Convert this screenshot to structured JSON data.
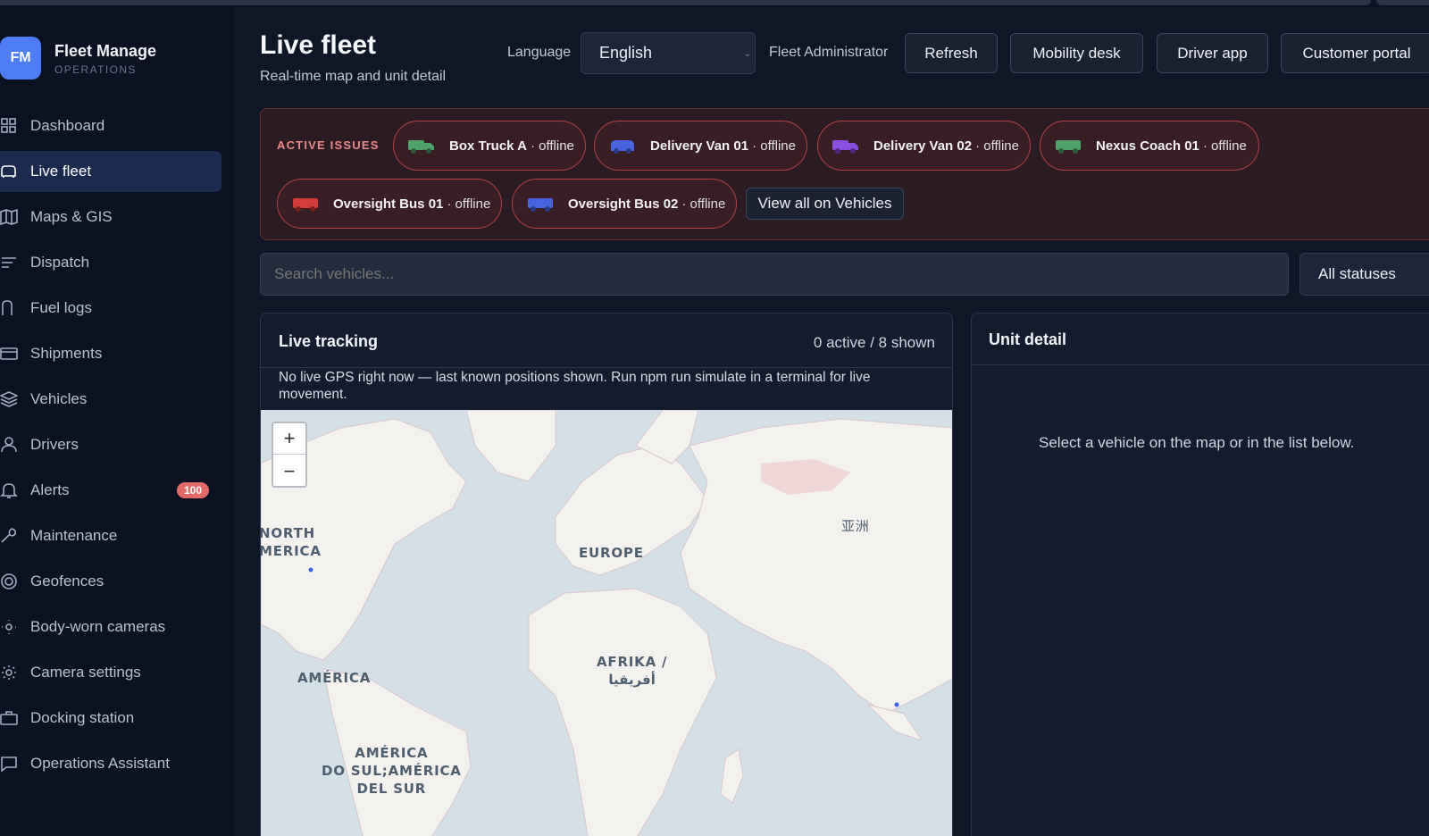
{
  "app": {
    "logo_initials": "FM",
    "name": "Fleet Manage",
    "subtitle": "OPERATIONS"
  },
  "sidebar": {
    "items": [
      {
        "label": "Dashboard",
        "icon": "grid-icon"
      },
      {
        "label": "Live fleet",
        "icon": "car-icon",
        "active": true
      },
      {
        "label": "Maps & GIS",
        "icon": "map-icon"
      },
      {
        "label": "Dispatch",
        "icon": "list-icon"
      },
      {
        "label": "Fuel logs",
        "icon": "fuel-icon"
      },
      {
        "label": "Shipments",
        "icon": "card-icon"
      },
      {
        "label": "Vehicles",
        "icon": "layers-icon"
      },
      {
        "label": "Drivers",
        "icon": "user-icon"
      },
      {
        "label": "Alerts",
        "icon": "bell-icon",
        "badge": "100"
      },
      {
        "label": "Maintenance",
        "icon": "wrench-icon"
      },
      {
        "label": "Geofences",
        "icon": "target-icon"
      },
      {
        "label": "Body-worn cameras",
        "icon": "camera-icon"
      },
      {
        "label": "Camera settings",
        "icon": "gear-icon"
      },
      {
        "label": "Docking station",
        "icon": "briefcase-icon"
      },
      {
        "label": "Operations Assistant",
        "icon": "chat-icon"
      }
    ]
  },
  "header": {
    "title": "Live fleet",
    "subtitle": "Real-time map and unit detail",
    "language_label": "Language",
    "language_value": "English",
    "role": "Fleet Administrator",
    "buttons": [
      "Refresh",
      "Mobility desk",
      "Driver app",
      "Customer portal"
    ]
  },
  "issues": {
    "title": "ACTIVE ISSUES",
    "chips": [
      {
        "name": "Box Truck A",
        "status": "· offline",
        "color": "#4fa36a"
      },
      {
        "name": "Delivery Van 01",
        "status": "· offline",
        "color": "#4a63e0"
      },
      {
        "name": "Delivery Van 02",
        "status": "· offline",
        "color": "#8a4fe0"
      },
      {
        "name": "Nexus Coach 01",
        "status": "· offline",
        "color": "#4fa36a"
      },
      {
        "name": "Oversight Bus 01",
        "status": "· offline",
        "color": "#d43b3b"
      },
      {
        "name": "Oversight Bus 02",
        "status": "· offline",
        "color": "#4a63e0"
      }
    ],
    "view_all": "View all on Vehicles"
  },
  "search": {
    "placeholder": "Search vehicles...",
    "status_value": "All statuses"
  },
  "tracking": {
    "title": "Live tracking",
    "count": "0 active / 8 shown",
    "notice": "No live GPS right now — last known positions shown. Run npm run simulate in a terminal for live movement.",
    "zoom_in": "+",
    "zoom_out": "−",
    "map_labels": {
      "north_america": "NORTH\nMERICA",
      "europe": "EUROPE",
      "asia": "亚洲",
      "america": "AMÉRICA",
      "africa": "AFRIKA /\nأفريقيا",
      "south_america": "AMÉRICA\nDO SUL;AMÉRICA\nDEL SUR"
    }
  },
  "unit_detail": {
    "title": "Unit detail",
    "empty": "Select a vehicle on the map or in the list below."
  },
  "colors": {
    "accent": "#4f7cf7",
    "active_nav": "#1b2a4d",
    "issue_border": "#b3434c",
    "badge": "#e46a6a"
  }
}
